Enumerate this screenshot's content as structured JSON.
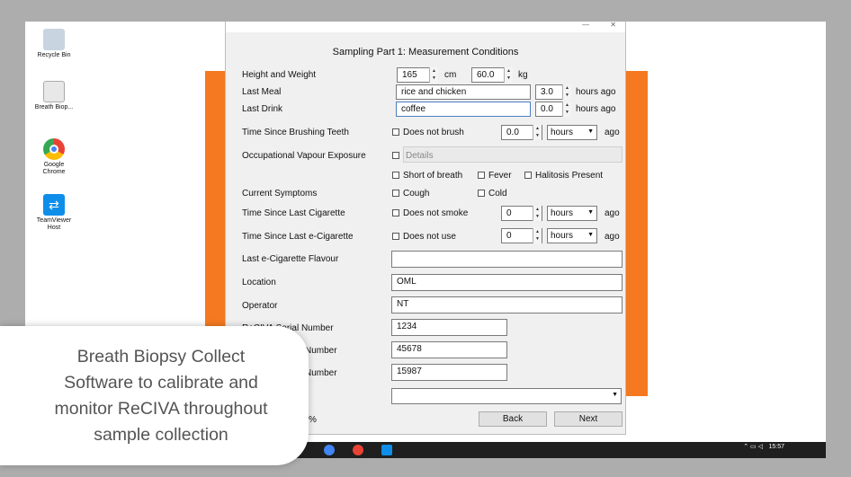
{
  "desktop": {
    "icons": [
      {
        "label": "Recycle Bin",
        "color": "#c8d4e0"
      },
      {
        "label": "Breath Biop...",
        "color": "#e8e8e8"
      },
      {
        "label": "Google Chrome",
        "color": "#e74c3c"
      },
      {
        "label": "TeamViewer Host",
        "color": "#0e8ee9"
      }
    ]
  },
  "dialog": {
    "heading": "Sampling Part 1: Measurement Conditions",
    "height_weight": {
      "label": "Height and Weight",
      "height": "165",
      "height_unit": "cm",
      "weight": "60.0",
      "weight_unit": "kg"
    },
    "last_meal": {
      "label": "Last Meal",
      "value": "rice and chicken",
      "hours": "3.0",
      "suffix": "hours ago"
    },
    "last_drink": {
      "label": "Last Drink",
      "value": "coffee",
      "hours": "0.0",
      "suffix": "hours ago"
    },
    "brushing": {
      "label": "Time Since Brushing Teeth",
      "check": "Does not brush",
      "value": "0.0",
      "unit": "hours",
      "suffix": "ago"
    },
    "vapour": {
      "label": "Occupational Vapour Exposure",
      "details_placeholder": "Details"
    },
    "symptoms": {
      "label": "Current Symptoms",
      "short_breath": "Short of breath",
      "fever": "Fever",
      "halitosis": "Halitosis Present",
      "cough": "Cough",
      "cold": "Cold"
    },
    "cigarette": {
      "label": "Time Since Last Cigarette",
      "check": "Does not smoke",
      "value": "0",
      "unit": "hours",
      "suffix": "ago"
    },
    "ecig": {
      "label": "Time Since Last e-Cigarette",
      "check": "Does not use",
      "value": "0",
      "unit": "hours",
      "suffix": "ago"
    },
    "flavour": {
      "label": "Last e-Cigarette Flavour",
      "value": ""
    },
    "location": {
      "label": "Location",
      "value": "OML"
    },
    "operator": {
      "label": "Operator",
      "value": "NT"
    },
    "reciva_serial": {
      "label": "ReCIVA Serial Number",
      "value": "1234"
    },
    "serial2": {
      "label": "Number",
      "value": "45678"
    },
    "serial3": {
      "label": "Number",
      "value": "15987"
    },
    "percent_text": "%",
    "back": "Back",
    "next": "Next"
  },
  "taskbar": {
    "time": "15:57"
  },
  "caption": {
    "line1": "Breath Biopsy Collect",
    "line2": "Software to calibrate and",
    "line3": "monitor ReCIVA throughout",
    "line4": "sample collection"
  }
}
